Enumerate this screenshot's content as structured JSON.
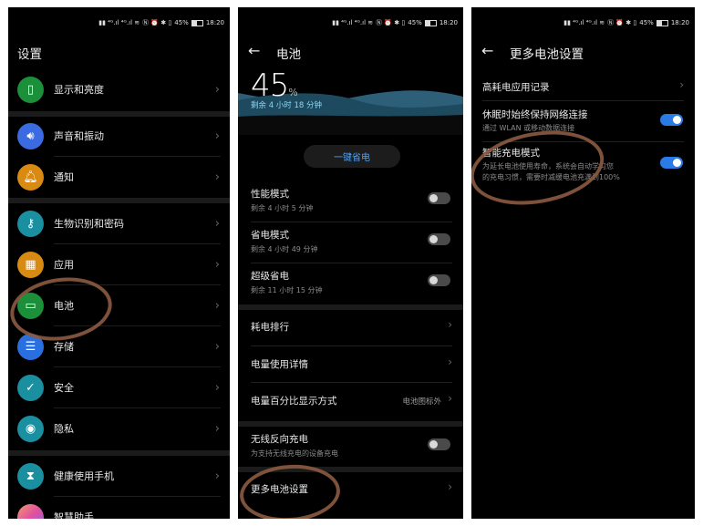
{
  "status": {
    "time": "18:20",
    "battery": "45%"
  },
  "s1": {
    "title": "设置",
    "items": [
      {
        "label": "显示和亮度"
      },
      {
        "label": "声音和振动"
      },
      {
        "label": "通知"
      },
      {
        "label": "生物识别和密码"
      },
      {
        "label": "应用"
      },
      {
        "label": "电池"
      },
      {
        "label": "存储"
      },
      {
        "label": "安全"
      },
      {
        "label": "隐私"
      },
      {
        "label": "健康使用手机"
      },
      {
        "label": "智慧助手"
      }
    ],
    "colors": {
      "display": "#1b8f3a",
      "sound": "#3a6be0",
      "notify": "#d88a12",
      "bio": "#1a8fa0",
      "apps": "#d88a12",
      "battery": "#1b8f3a",
      "storage": "#2a6fe0",
      "security": "#1a8fa0",
      "privacy": "#1a8fa0",
      "health": "#1a8fa0"
    }
  },
  "s2": {
    "title": "电池",
    "percent": "45",
    "percent_unit": "%",
    "remaining": "剩余 4 小时 18 分钟",
    "save_button": "一键省电",
    "modes": [
      {
        "title": "性能模式",
        "sub": "剩余 4 小时 5 分钟",
        "on": false
      },
      {
        "title": "省电模式",
        "sub": "剩余 4 小时 49 分钟",
        "on": false
      },
      {
        "title": "超级省电",
        "sub": "剩余 11 小时 15 分钟",
        "on": false
      }
    ],
    "links": [
      {
        "title": "耗电排行"
      },
      {
        "title": "电量使用详情"
      },
      {
        "title": "电量百分比显示方式",
        "value": "电池图标外"
      }
    ],
    "wireless": {
      "title": "无线反向充电",
      "sub": "为支持无线充电的设备充电",
      "on": false
    },
    "more": {
      "title": "更多电池设置"
    }
  },
  "s3": {
    "title": "更多电池设置",
    "items": [
      {
        "title": "高耗电应用记录"
      },
      {
        "title": "休眠时始终保持网络连接",
        "sub": "通过 WLAN 或移动数据连接",
        "on": true
      },
      {
        "title": "智能充电模式",
        "sub1": "为延长电池使用寿命，系统会自动学习您",
        "sub2": "的充电习惯，需要时减缓电池充满到100%",
        "on": true
      }
    ]
  }
}
